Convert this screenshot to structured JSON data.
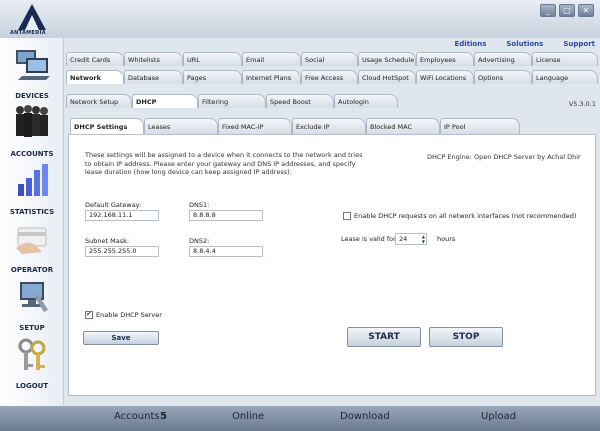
{
  "app": {
    "logo_text": "ANTAMEDIA"
  },
  "window_buttons": [
    "_",
    "▢",
    "✕"
  ],
  "links": [
    "Editions",
    "Solutions",
    "Support"
  ],
  "sidebar": [
    {
      "label": "DEVICES",
      "icon": "devices-icon"
    },
    {
      "label": "ACCOUNTS",
      "icon": "accounts-icon"
    },
    {
      "label": "STATISTICS",
      "icon": "statistics-icon"
    },
    {
      "label": "OPERATOR",
      "icon": "operator-icon"
    },
    {
      "label": "SETUP",
      "icon": "setup-icon"
    },
    {
      "label": "LOGOUT",
      "icon": "logout-icon"
    }
  ],
  "tabs_row1": [
    "Credit Cards",
    "Whitelists",
    "URL",
    "Email",
    "Social",
    "Usage Schedule",
    "Employees",
    "Advertising",
    "License"
  ],
  "tabs_row2": [
    "Network",
    "Database",
    "Pages",
    "Internet Plans",
    "Free Access",
    "Cloud HotSpot",
    "WiFi Locations",
    "Options",
    "Language"
  ],
  "tabs_row3": [
    "Network Setup",
    "DHCP",
    "Filtering",
    "Speed Boost",
    "Autologin"
  ],
  "tabs_row4": [
    "DHCP Settings",
    "Leases",
    "Fixed MAC-IP",
    "Exclude IP",
    "Blocked MAC",
    "IP Pool"
  ],
  "version": "V5.3.0.1",
  "dhcp": {
    "description": "These settings will be assigned to a device when it connects to the network and tries to obtain IP address. Please enter your gateway and DNS IP addresses, and specify lease duration (how long device can keep assigned IP address).",
    "engine": "DHCP Engine: Open DHCP Server by Achal Dhir",
    "gateway_label": "Default Gateway:",
    "gateway_value": "192.168.11.1",
    "dns1_label": "DNS1:",
    "dns1_value": "8.8.8.8",
    "subnet_label": "Subnet Mask:",
    "subnet_value": "255.255.255.0",
    "dns2_label": "DNS2:",
    "dns2_value": "8.8.4.4",
    "all_interfaces_label": "Enable DHCP requests on all network interfaces (not recommended)",
    "all_interfaces_checked": false,
    "lease_label": "Lease is valid for",
    "lease_value": "24",
    "lease_unit": "hours",
    "enable_label": "Enable DHCP Server",
    "enable_checked": true,
    "save_label": "Save",
    "start_label": "START",
    "stop_label": "STOP"
  },
  "status": {
    "accounts_label": "Accounts",
    "accounts_count": "5",
    "online_label": "Online",
    "download_label": "Download",
    "upload_label": "Upload"
  }
}
